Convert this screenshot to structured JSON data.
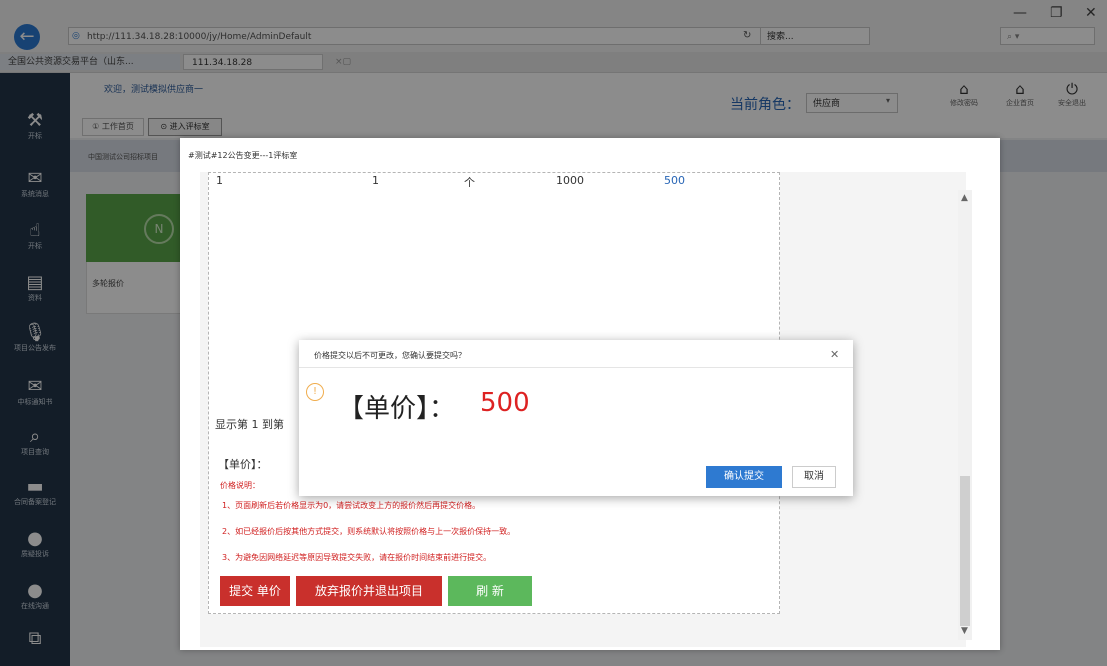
{
  "browser": {
    "url": "http://111.34.18.28:10000/jy/Home/AdminDefault",
    "search_text": "搜索...",
    "search_placeholder": "",
    "tabs": [
      {
        "label": "全国公共资源交易平台（山东..."
      },
      {
        "label": "111.34.18.28"
      }
    ]
  },
  "sidebar": {
    "items": [
      {
        "label": "开标",
        "icon": "hammer-icon"
      },
      {
        "label": "系统消息",
        "icon": "mail-icon"
      },
      {
        "label": "开标",
        "icon": "hand-icon"
      },
      {
        "label": "资料",
        "icon": "archive-icon"
      },
      {
        "label": "项目公告发布",
        "icon": "mic-icon"
      },
      {
        "label": "中标通知书",
        "icon": "envelope-icon"
      },
      {
        "label": "项目查询",
        "icon": "search-icon"
      },
      {
        "label": "合同备案登记",
        "icon": "card-icon"
      },
      {
        "label": "质疑投诉",
        "icon": "chat-icon"
      },
      {
        "label": "在线沟通",
        "icon": "chat-icon"
      },
      {
        "label": "",
        "icon": "copy-icon"
      }
    ]
  },
  "header": {
    "welcome": "欢迎，测试模拟供应商一",
    "tabs": [
      {
        "label": "① 工作首页"
      },
      {
        "label": "⊙ 进入评标室"
      }
    ],
    "role_label": "当前角色：",
    "role_value": "供应商",
    "icons": [
      {
        "label": "修改密码",
        "icon": "home-icon"
      },
      {
        "label": "企业首页",
        "icon": "home-icon"
      },
      {
        "label": "安全退出",
        "icon": "power-icon"
      }
    ]
  },
  "background": {
    "breadcrumb": "中国测试公司招标项目",
    "card_label": "多轮报价"
  },
  "modal": {
    "title": "#测试#12公告变更---1评标室",
    "table_row": [
      "1",
      "1",
      "个",
      "1000",
      "500"
    ],
    "table_info": "显示第 1 到第",
    "price_label": "【单价】：",
    "notes_title": "价格说明：",
    "notes": [
      "1、页面刷新后若价格显示为0，请尝试改变上方的报价然后再提交价格。",
      "2、如已经报价后按其他方式提交，则系统默认将按照价格与上一次报价保持一致。",
      "3、为避免因网络延迟等原因导致提交失败，请在报价时间结束前进行提交。"
    ],
    "buttons": {
      "submit": "提交 单价",
      "quit": "放弃报价并退出项目",
      "refresh": "刷 新"
    }
  },
  "dialog": {
    "title": "价格提交以后不可更改，您确认要提交吗？",
    "label": "【单价】：",
    "value": "500",
    "confirm": "确认提交",
    "cancel": "取消"
  },
  "colors": {
    "sidebar": "#23364a",
    "accent": "#2e7ad1",
    "danger": "#c9302c",
    "success": "#5cb85c",
    "price": "#dd2222"
  }
}
